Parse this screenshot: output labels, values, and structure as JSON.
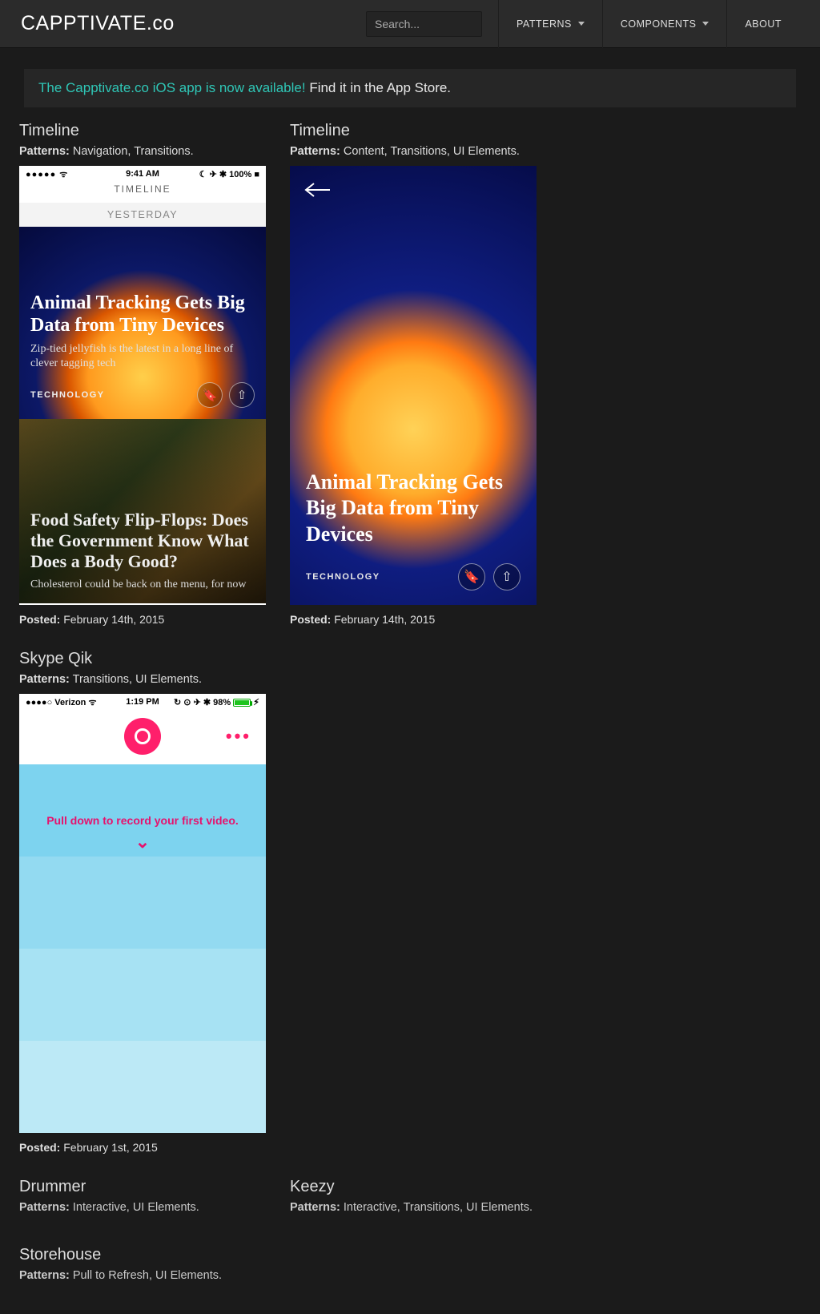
{
  "brand": "CAPPTIVATE.co",
  "search": {
    "placeholder": "Search..."
  },
  "nav": {
    "patterns": "PATTERNS",
    "components": "COMPONENTS",
    "about": "ABOUT"
  },
  "announce": {
    "teal": "The Capptivate.co iOS app is now available!",
    "white": "Find it in the App Store."
  },
  "labels": {
    "patterns_prefix": "Patterns:",
    "posted_prefix": "Posted:"
  },
  "cards": [
    {
      "title": "Timeline",
      "patterns": "Navigation, Transitions.",
      "posted": "February 14th, 2015",
      "preview": {
        "status_left": "●●●●●  ᯤ",
        "status_time": "9:41 AM",
        "status_right": "☾ ✈︎ ✱ 100% ■",
        "bar_title": "TIMELINE",
        "section": "YESTERDAY",
        "story1": {
          "headline": "Animal Tracking Gets Big Data from Tiny Devices",
          "sub": "Zip-tied jellyfish is the latest in a long line of clever tagging tech",
          "category": "TECHNOLOGY"
        },
        "story2": {
          "headline": "Food Safety Flip-Flops: Does the Government Know What Does a Body Good?",
          "sub": "Cholesterol could be back on the menu, for now"
        }
      }
    },
    {
      "title": "Timeline",
      "patterns": "Content, Transitions, UI Elements.",
      "posted": "February 14th, 2015",
      "preview": {
        "headline": "Animal Tracking Gets Big Data from Tiny Devices",
        "category": "TECHNOLOGY"
      }
    },
    {
      "title": "Skype Qik",
      "patterns": "Transitions, UI Elements.",
      "posted": "February 1st, 2015",
      "preview": {
        "status_left": "●●●●○ Verizon  ᯤ",
        "status_time": "1:19 PM",
        "status_right_pct": "98%",
        "hint": "Pull down to record your first video."
      }
    },
    {
      "title": "Drummer",
      "patterns": "Interactive, UI Elements."
    },
    {
      "title": "Keezy",
      "patterns": "Interactive, Transitions, UI Elements."
    },
    {
      "title": "Storehouse",
      "patterns": "Pull to Refresh, UI Elements."
    }
  ]
}
